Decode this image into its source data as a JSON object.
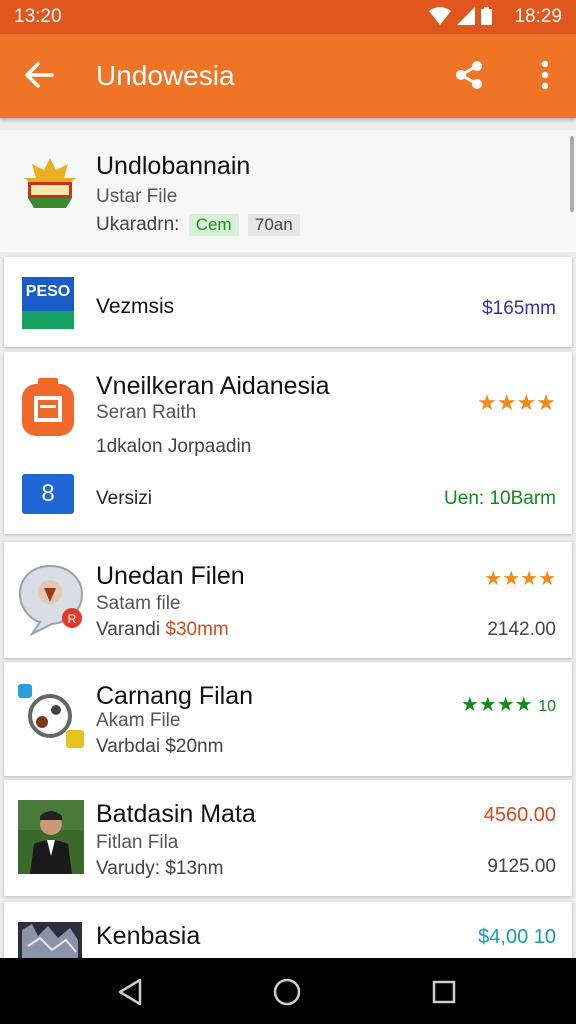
{
  "status": {
    "time_left": "13:20",
    "time_right": "18:29"
  },
  "appbar": {
    "title": "Undowesia"
  },
  "items": [
    {
      "title": "Undlobannain",
      "subtitle": "Ustar File",
      "meta": "Ukaradrn:",
      "chip1": "Cem",
      "chip2": "70an"
    },
    {
      "logo_text": "PESO",
      "title": "Vezmsis",
      "right": "$165mm"
    },
    {
      "title": "Vneilkeran Aidanesia",
      "subtitle": "Seran Raith",
      "meta": "1dkalon Jorpaadin",
      "stars": "★★★★",
      "sub_icon_text": "8",
      "sub_title": "Versizi",
      "sub_right": "Uen: 10Barm"
    },
    {
      "title": "Unedan Filen",
      "subtitle": "Satam file",
      "meta_label": "Varandi",
      "meta_value": "$30mm",
      "stars": "★★★★",
      "right": "2142.00"
    },
    {
      "title": "Carnang Filan",
      "subtitle": "Akam File",
      "meta": "Varbdai $20nm",
      "stars": "★★★★",
      "stars_suffix": "10"
    },
    {
      "title": "Batdasin Mata",
      "subtitle": "Fitlan Fila",
      "meta": "Varudy: $13nm",
      "right_top": "4560.00",
      "right": "9125.00"
    },
    {
      "title": "Kenbasia",
      "right_top": "$4,00 10"
    }
  ],
  "colors": {
    "appbar": "#f07426",
    "status": "#e0561c",
    "star_orange": "#ef8a1c",
    "star_green": "#138a1e",
    "price_blue": "#3a2fb0",
    "green": "#118a1e",
    "red": "#d94a1a",
    "teal": "#14a0a8"
  }
}
